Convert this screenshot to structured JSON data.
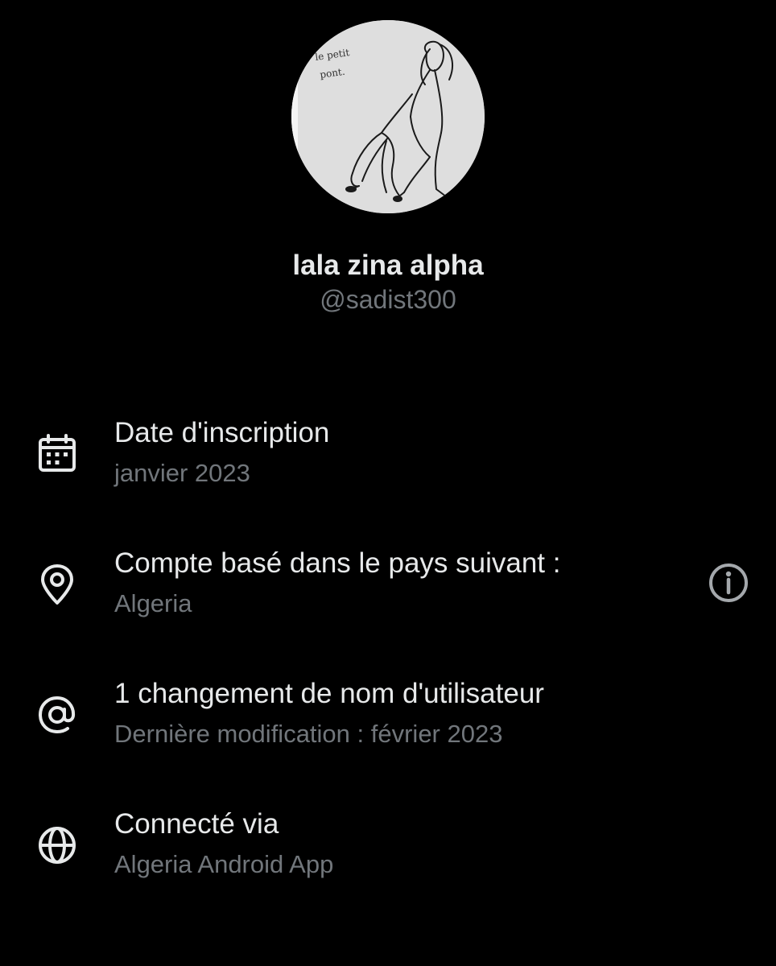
{
  "profile": {
    "display_name": "lala zina alpha",
    "handle": "@sadist300",
    "avatar_caption": "le petit pont."
  },
  "rows": [
    {
      "icon": "calendar-icon",
      "title": "Date d'inscription",
      "subtitle": "janvier 2023"
    },
    {
      "icon": "location-pin-icon",
      "title": "Compte basé dans le pays suivant :",
      "subtitle": "Algeria",
      "action_icon": "info-icon"
    },
    {
      "icon": "at-sign-icon",
      "title": "1 changement de nom d'utilisateur",
      "subtitle": "Dernière modification : février 2023"
    },
    {
      "icon": "globe-icon",
      "title": "Connecté via",
      "subtitle": "Algeria Android App"
    }
  ],
  "colors": {
    "background": "#000000",
    "primary_text": "#e7e9ea",
    "secondary_text": "#71767b"
  }
}
